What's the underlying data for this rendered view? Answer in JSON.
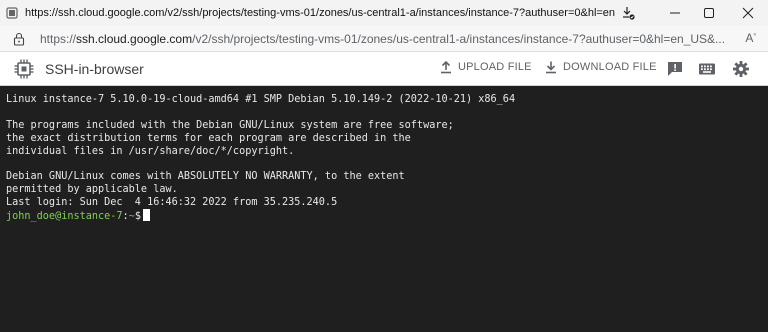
{
  "browser": {
    "window_title": "https://ssh.cloud.google.com/v2/ssh/projects/testing-vms-01/zones/us-central1-a/instances/instance-7?authuser=0&hl=en_US&...",
    "address_scheme": "https://",
    "address_host": "ssh.cloud.google.com",
    "address_path": "/v2/ssh/projects/testing-vms-01/zones/us-central1-a/instances/instance-7?authuser=0&hl=en_US&...",
    "reader_mode": "A",
    "icons": [
      "favicon",
      "downloads-icon",
      "minimize-icon",
      "maximize-icon",
      "close-icon",
      "lock-icon",
      "read-aloud-icon"
    ]
  },
  "app": {
    "title": "SSH-in-browser",
    "upload_label": "UPLOAD FILE",
    "download_label": "DOWNLOAD FILE",
    "icons": [
      "chip-icon",
      "upload-icon",
      "download-icon",
      "feedback-icon",
      "keyboard-icon",
      "settings-icon"
    ]
  },
  "terminal": {
    "lines": [
      "Linux instance-7 5.10.0-19-cloud-amd64 #1 SMP Debian 5.10.149-2 (2022-10-21) x86_64",
      "",
      "The programs included with the Debian GNU/Linux system are free software;",
      "the exact distribution terms for each program are described in the",
      "individual files in /usr/share/doc/*/copyright.",
      "",
      "Debian GNU/Linux comes with ABSOLUTELY NO WARRANTY, to the extent",
      "permitted by applicable law.",
      "Last login: Sun Dec  4 16:46:32 2022 from 35.235.240.5"
    ],
    "prompt_user": "john_doe@instance-7",
    "prompt_sep": ":",
    "prompt_path": "~",
    "prompt_symbol": "$"
  },
  "colors": {
    "terminal_bg": "#1f1f1f",
    "terminal_fg": "#e8e8e8",
    "prompt_user": "#7fd14e",
    "prompt_path": "#6aa6ff"
  }
}
